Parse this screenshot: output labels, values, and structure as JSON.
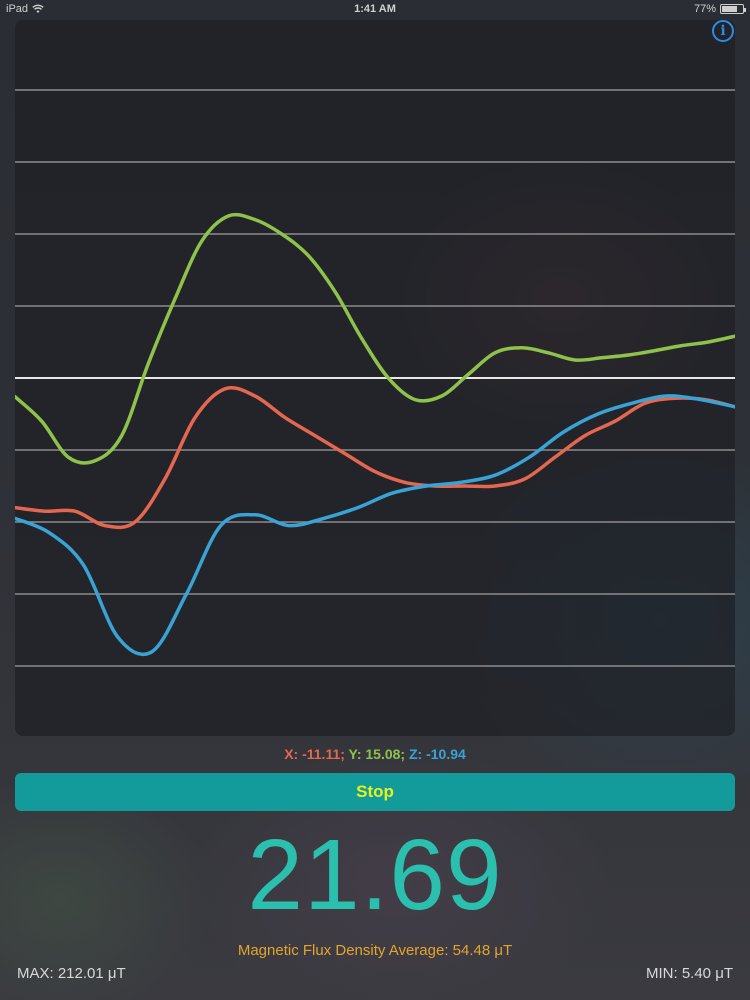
{
  "status_bar": {
    "device": "iPad",
    "time": "1:41 AM",
    "battery_text": "77%",
    "battery_level": 0.77
  },
  "graph": {
    "colors": {
      "x": "#e5674f",
      "y": "#8fc24a",
      "z": "#3aa3d6",
      "grid": "#8c8c8c",
      "zero": "#e8e8e8"
    },
    "series": {
      "y": [
        -0.26,
        -0.6,
        -1.1,
        -1.15,
        -0.8,
        0.2,
        1.1,
        1.9,
        2.25,
        2.2,
        2.0,
        1.7,
        1.2,
        0.55,
        0.0,
        -0.3,
        -0.25,
        0.05,
        0.35,
        0.42,
        0.35,
        0.25,
        0.28,
        0.32,
        0.38,
        0.45,
        0.5,
        0.58
      ],
      "x": [
        -1.8,
        -1.85,
        -1.85,
        -2.05,
        -2.0,
        -1.4,
        -0.55,
        -0.15,
        -0.25,
        -0.55,
        -0.8,
        -1.05,
        -1.3,
        -1.45,
        -1.5,
        -1.5,
        -1.5,
        -1.4,
        -1.1,
        -0.8,
        -0.6,
        -0.35,
        -0.28,
        -0.3,
        -0.4
      ],
      "z": [
        -1.95,
        -2.15,
        -2.6,
        -3.6,
        -3.8,
        -3.0,
        -2.05,
        -1.9,
        -2.05,
        -1.95,
        -1.8,
        -1.6,
        -1.5,
        -1.45,
        -1.35,
        -1.1,
        -0.75,
        -0.5,
        -0.35,
        -0.25,
        -0.3,
        -0.4
      ]
    }
  },
  "info_button": {
    "label": "i"
  },
  "readout": {
    "x_text": "X: -11.11;",
    "y_text": "Y: 15.08;",
    "z_text": "Z: -10.94"
  },
  "stop_button": {
    "label": "Stop"
  },
  "magnitude": {
    "value": "21.69"
  },
  "average": {
    "text": "Magnetic Flux Density Average: 54.48 μT"
  },
  "max": {
    "text": "MAX: 212.01 μT"
  },
  "min": {
    "text": "MIN: 5.40 μT"
  }
}
